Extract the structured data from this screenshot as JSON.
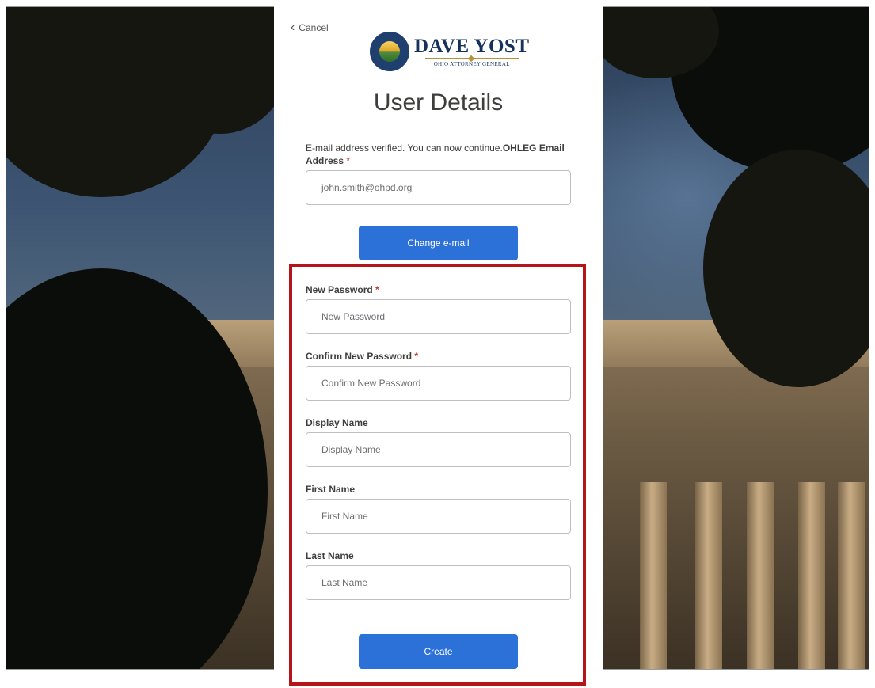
{
  "cancel": {
    "label": "Cancel"
  },
  "logo": {
    "name": "DAVE YOST",
    "subtitle": "OHIO ATTORNEY GENERAL"
  },
  "form": {
    "title": "User Details",
    "verified_message": "E-mail address verified. You can now continue.",
    "email_label": "OHLEG Email Address",
    "email_value": "john.smith@ohpd.org",
    "change_email_label": "Change e-mail",
    "required_mark": "*",
    "new_password": {
      "label": "New Password",
      "placeholder": "New Password"
    },
    "confirm_password": {
      "label": "Confirm New Password",
      "placeholder": "Confirm New Password"
    },
    "display_name": {
      "label": "Display Name",
      "placeholder": "Display Name"
    },
    "first_name": {
      "label": "First Name",
      "placeholder": "First Name"
    },
    "last_name": {
      "label": "Last Name",
      "placeholder": "Last Name"
    },
    "create_label": "Create"
  },
  "colors": {
    "primary_button": "#2b71d8",
    "required": "#c23934",
    "highlight": "#b5141b",
    "brand_navy": "#16325c"
  }
}
